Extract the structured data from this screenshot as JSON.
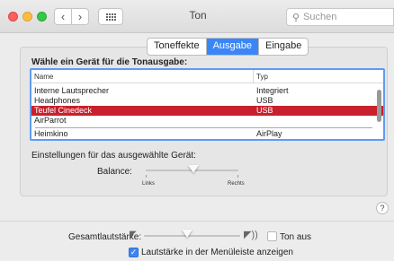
{
  "window": {
    "title": "Ton"
  },
  "toolbar": {
    "back": "‹",
    "forward": "›",
    "search_placeholder": "Suchen"
  },
  "tabs": [
    {
      "label": "Toneffekte",
      "active": false
    },
    {
      "label": "Ausgabe",
      "active": true
    },
    {
      "label": "Eingabe",
      "active": false
    }
  ],
  "output": {
    "heading": "Wähle ein Gerät für die Tonausgabe:",
    "columns": {
      "name": "Name",
      "type": "Typ"
    },
    "devices": [
      {
        "name": "Interne Lautsprecher",
        "type": "Integriert"
      },
      {
        "name": "Headphones",
        "type": "USB"
      },
      {
        "name": "Teufel Cinedeck",
        "type": "USB",
        "selected": true
      },
      {
        "name": "AirParrot",
        "type": ""
      },
      {
        "name": "Heimkino",
        "type": "AirPlay"
      }
    ]
  },
  "settings": {
    "heading": "Einstellungen für das ausgewählte Gerät:",
    "balance_label": "Balance:",
    "balance_left": "Links",
    "balance_right": "Rechts",
    "balance_value": 0.5
  },
  "volume": {
    "label": "Gesamtlautstärke:",
    "level": 0.4,
    "mute_label": "Ton aus",
    "mute_checked": false,
    "menubar_label": "Lautstärke in der Menüleiste anzeigen",
    "menubar_checked": true
  },
  "help": "?",
  "colors": {
    "accent": "#3b86f7",
    "selection": "#c8202c"
  }
}
